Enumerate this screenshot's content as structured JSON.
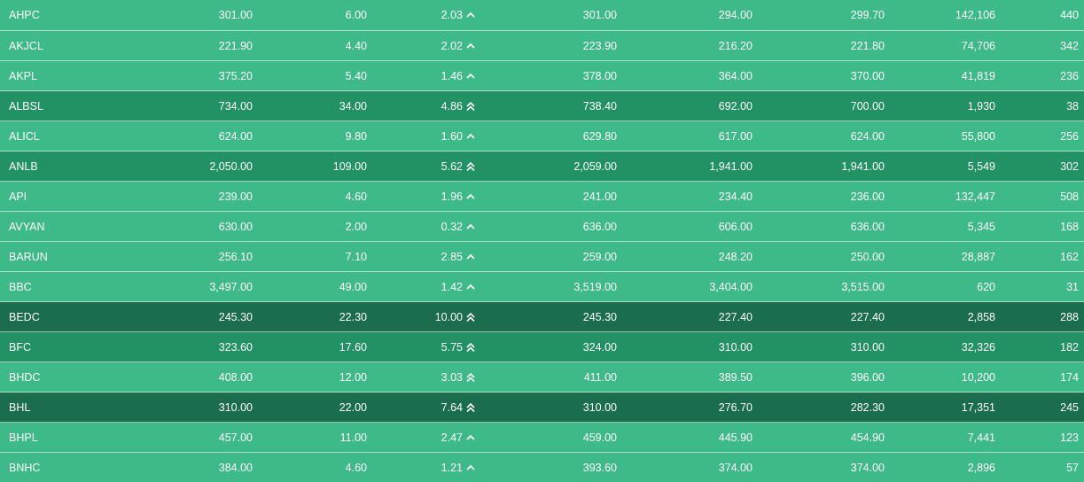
{
  "colors": {
    "row_level_1": "#3dba88",
    "row_level_2": "#229163",
    "row_level_3": "#1b6e4d",
    "text": "#ffffff"
  },
  "icons": {
    "single_up": "chevron-up-icon",
    "double_up": "double-chevron-up-icon"
  },
  "rows": [
    {
      "symbol": "AHPC",
      "ltp": "301.00",
      "change": "6.00",
      "pct": "2.03",
      "arrow": "single",
      "level": 1,
      "open": "301.00",
      "high": "294.00",
      "low": "299.70",
      "volume": "142,106",
      "trades": "440"
    },
    {
      "symbol": "AKJCL",
      "ltp": "221.90",
      "change": "4.40",
      "pct": "2.02",
      "arrow": "single",
      "level": 1,
      "open": "223.90",
      "high": "216.20",
      "low": "221.80",
      "volume": "74,706",
      "trades": "342"
    },
    {
      "symbol": "AKPL",
      "ltp": "375.20",
      "change": "5.40",
      "pct": "1.46",
      "arrow": "single",
      "level": 1,
      "open": "378.00",
      "high": "364.00",
      "low": "370.00",
      "volume": "41,819",
      "trades": "236"
    },
    {
      "symbol": "ALBSL",
      "ltp": "734.00",
      "change": "34.00",
      "pct": "4.86",
      "arrow": "double",
      "level": 2,
      "open": "738.40",
      "high": "692.00",
      "low": "700.00",
      "volume": "1,930",
      "trades": "38"
    },
    {
      "symbol": "ALICL",
      "ltp": "624.00",
      "change": "9.80",
      "pct": "1.60",
      "arrow": "single",
      "level": 1,
      "open": "629.80",
      "high": "617.00",
      "low": "624.00",
      "volume": "55,800",
      "trades": "256"
    },
    {
      "symbol": "ANLB",
      "ltp": "2,050.00",
      "change": "109.00",
      "pct": "5.62",
      "arrow": "double",
      "level": 2,
      "open": "2,059.00",
      "high": "1,941.00",
      "low": "1,941.00",
      "volume": "5,549",
      "trades": "302"
    },
    {
      "symbol": "API",
      "ltp": "239.00",
      "change": "4.60",
      "pct": "1.96",
      "arrow": "single",
      "level": 1,
      "open": "241.00",
      "high": "234.40",
      "low": "236.00",
      "volume": "132,447",
      "trades": "508"
    },
    {
      "symbol": "AVYAN",
      "ltp": "630.00",
      "change": "2.00",
      "pct": "0.32",
      "arrow": "single",
      "level": 1,
      "open": "636.00",
      "high": "606.00",
      "low": "636.00",
      "volume": "5,345",
      "trades": "168"
    },
    {
      "symbol": "BARUN",
      "ltp": "256.10",
      "change": "7.10",
      "pct": "2.85",
      "arrow": "single",
      "level": 1,
      "open": "259.00",
      "high": "248.20",
      "low": "250.00",
      "volume": "28,887",
      "trades": "162"
    },
    {
      "symbol": "BBC",
      "ltp": "3,497.00",
      "change": "49.00",
      "pct": "1.42",
      "arrow": "single",
      "level": 1,
      "open": "3,519.00",
      "high": "3,404.00",
      "low": "3,515.00",
      "volume": "620",
      "trades": "31"
    },
    {
      "symbol": "BEDC",
      "ltp": "245.30",
      "change": "22.30",
      "pct": "10.00",
      "arrow": "double",
      "level": 3,
      "open": "245.30",
      "high": "227.40",
      "low": "227.40",
      "volume": "2,858",
      "trades": "288"
    },
    {
      "symbol": "BFC",
      "ltp": "323.60",
      "change": "17.60",
      "pct": "5.75",
      "arrow": "double",
      "level": 2,
      "open": "324.00",
      "high": "310.00",
      "low": "310.00",
      "volume": "32,326",
      "trades": "182"
    },
    {
      "symbol": "BHDC",
      "ltp": "408.00",
      "change": "12.00",
      "pct": "3.03",
      "arrow": "double",
      "level": 1,
      "open": "411.00",
      "high": "389.50",
      "low": "396.00",
      "volume": "10,200",
      "trades": "174"
    },
    {
      "symbol": "BHL",
      "ltp": "310.00",
      "change": "22.00",
      "pct": "7.64",
      "arrow": "double",
      "level": 3,
      "open": "310.00",
      "high": "276.70",
      "low": "282.30",
      "volume": "17,351",
      "trades": "245"
    },
    {
      "symbol": "BHPL",
      "ltp": "457.00",
      "change": "11.00",
      "pct": "2.47",
      "arrow": "single",
      "level": 1,
      "open": "459.00",
      "high": "445.90",
      "low": "454.90",
      "volume": "7,441",
      "trades": "123"
    },
    {
      "symbol": "BNHC",
      "ltp": "384.00",
      "change": "4.60",
      "pct": "1.21",
      "arrow": "single",
      "level": 1,
      "open": "393.60",
      "high": "374.00",
      "low": "374.00",
      "volume": "2,896",
      "trades": "57"
    }
  ]
}
